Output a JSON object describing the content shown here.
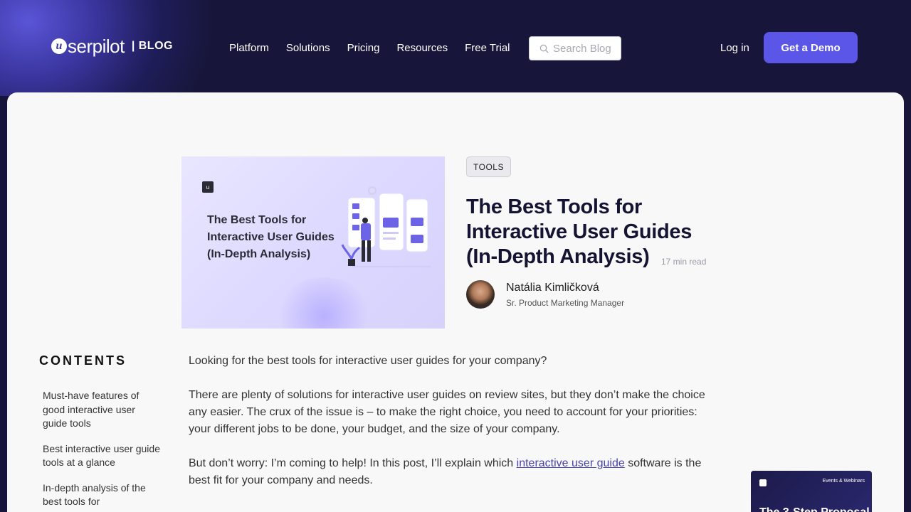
{
  "header": {
    "logo_badge": "u",
    "logo_text": "serpilot",
    "logo_section": "| BLOG",
    "nav": [
      "Platform",
      "Solutions",
      "Pricing",
      "Resources",
      "Free Trial"
    ],
    "search_placeholder": "Search Blog",
    "login_label": "Log in",
    "demo_label": "Get a Demo"
  },
  "article": {
    "hero_badge": "u",
    "hero_title": "The Best Tools for Interactive User Guides (In-Depth Analysis)",
    "tag": "TOOLS",
    "title": "The Best Tools for Interactive User Guides (In-Depth Analysis)",
    "read_time": "17 min read",
    "author_name": "Natália Kimličková",
    "author_role": "Sr. Product Marketing Manager"
  },
  "contents": {
    "heading": "CONTENTS",
    "items": [
      "Must-have features of good interactive user guide tools",
      "Best interactive user guide tools at a glance",
      "In-depth analysis of the best tools for"
    ]
  },
  "body": {
    "p1": "Looking for the best tools for interactive user guides for your company?",
    "p2": "There are plenty of solutions for interactive user guides on review sites, but they don’t make the choice any easier. The crux of the issue is – to make the right choice, you need to account for your priorities: your different jobs to be done, your budget, and the size of your company.",
    "p3_before": "But don’t worry: I’m coming to help! In this post, I’ll explain which ",
    "p3_link": "interactive user guide",
    "p3_after": " software is the best fit for your company and needs."
  },
  "promo": {
    "label": "Events & Webinars",
    "title": "The 3-Step Proposal"
  },
  "colors": {
    "navy": "#17163a",
    "accent": "#5b55e8",
    "link": "#4945a8"
  }
}
